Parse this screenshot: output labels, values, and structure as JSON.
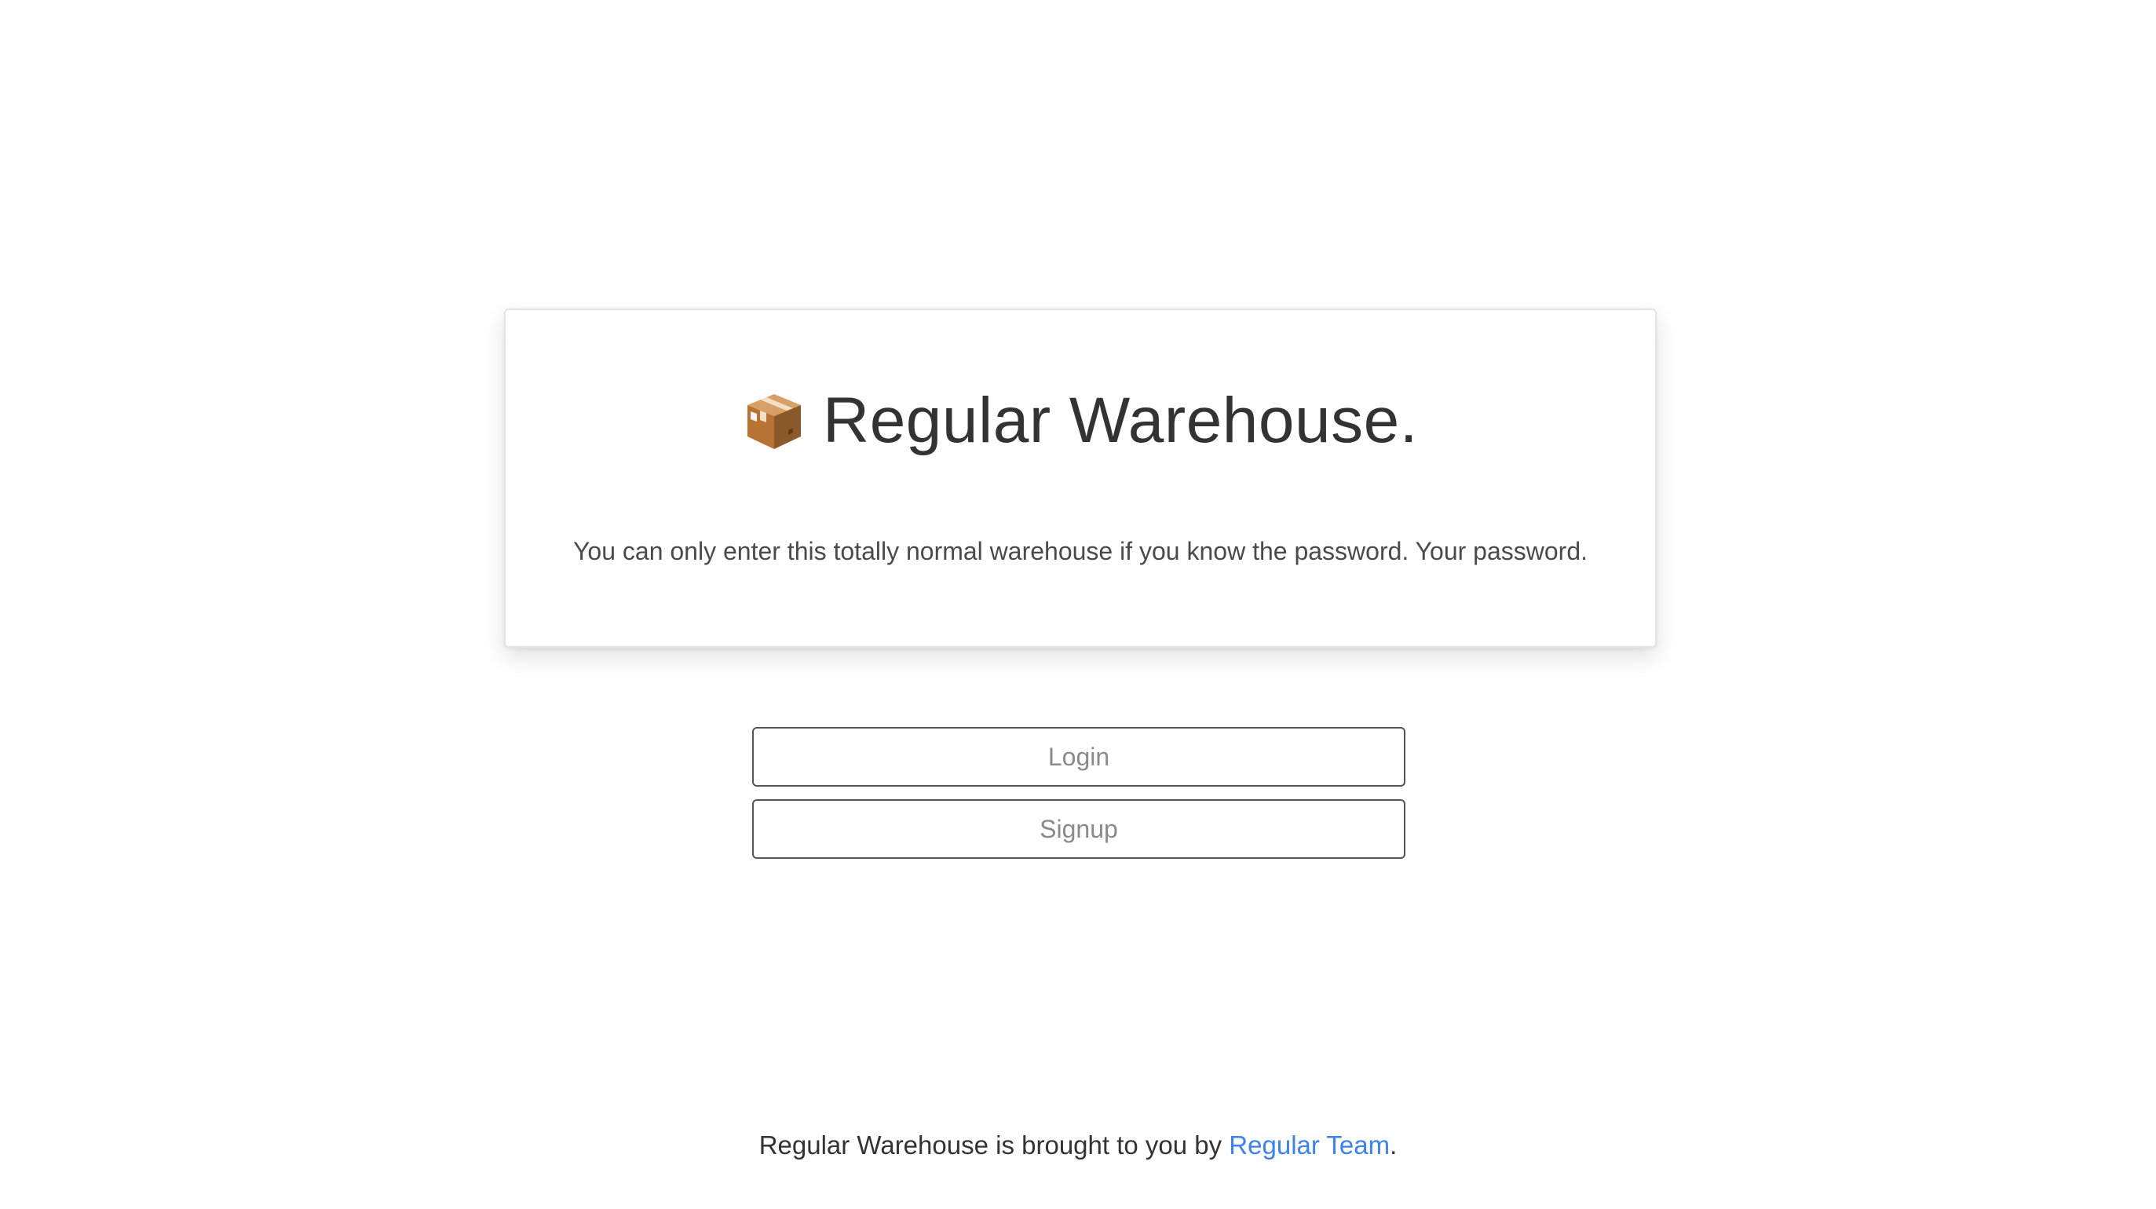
{
  "card": {
    "title": "Regular Warehouse.",
    "title_icon": "package-box-icon",
    "subtitle": "You can only enter this totally normal warehouse if you know the password. Your password."
  },
  "actions": {
    "login_label": "Login",
    "signup_label": "Signup"
  },
  "footer": {
    "text": "Regular Warehouse is brought to you by ",
    "link_text": "Regular Team",
    "trailing": "."
  },
  "colors": {
    "link": "#3b82f6",
    "button_border": "#555555",
    "button_text": "#8a8a8a"
  }
}
